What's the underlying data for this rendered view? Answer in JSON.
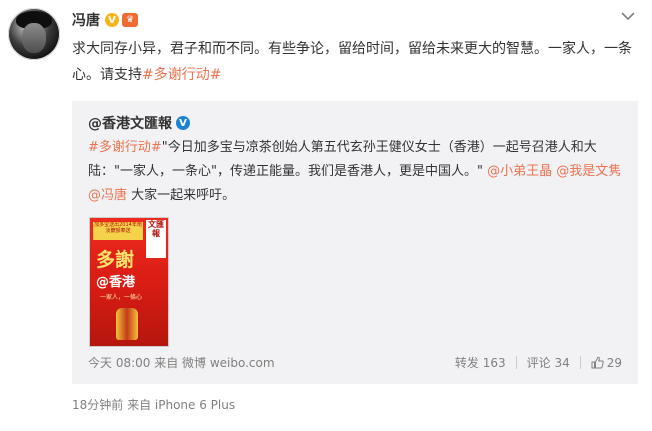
{
  "post": {
    "author_name": "冯唐",
    "text_before": "求大同存小异，君子和而不同。有些争论，留给时间，留给未来更大的智慧。一家人，一条心。请支持",
    "hashtag": "#多谢行动#",
    "footer": "18分钟前 来自 iPhone 6 Plus"
  },
  "repost": {
    "author": "@香港文匯報",
    "hashtag": "#多谢行动#",
    "text_main": "\"今日加多宝与凉茶创始人第五代玄孙王健仪女士（香港）一起号召港人和大陆：\"一家人，一条心\"，传递正能量。我们是香港人，更是中国人。\" ",
    "mention1": "@小弟王晶",
    "mention2": "@我是文隽",
    "mention3": "@冯唐",
    "text_tail": " 大家一起来呼吁。",
    "time": "今天 08:00 来自 微博 weibo.com",
    "repost_count": "转发 163",
    "comment_count": "评论 34",
    "like_count": "29"
  },
  "thumbnail": {
    "banner": "加多宝送出2014年南淡鍍額奉送",
    "logo": "文匯報",
    "big": "多謝",
    "mid": "@香港",
    "small": "一家人，一條心"
  },
  "icons": {
    "vip": "vip-v-badge",
    "member": "member-crown",
    "verify": "blue-v-verify",
    "chevron": "chevron-down",
    "like": "thumbs-up"
  },
  "colors": {
    "link": "#eb7350",
    "repost_bg": "#f2f2f5",
    "meta": "#808080",
    "vip": "#f7b418",
    "verify": "#1e82d2"
  }
}
